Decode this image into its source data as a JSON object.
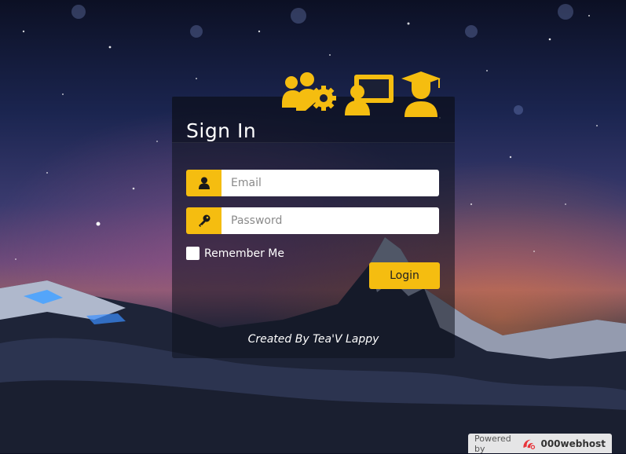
{
  "login_panel": {
    "title": "Sign In",
    "email_placeholder": "Email",
    "password_placeholder": "Password",
    "remember_label": "Remember Me",
    "login_label": "Login",
    "credit": "Created By Tea'V Lappy"
  },
  "header_icons": [
    "users-gear-icon",
    "teacher-screen-icon",
    "graduate-icon"
  ],
  "footer": {
    "powered_by": "Powered by",
    "brand": "000webhost"
  },
  "colors": {
    "accent": "#f5bd10",
    "panel_bg": "rgba(15,18,30,0.55)",
    "text": "#ffffff"
  }
}
